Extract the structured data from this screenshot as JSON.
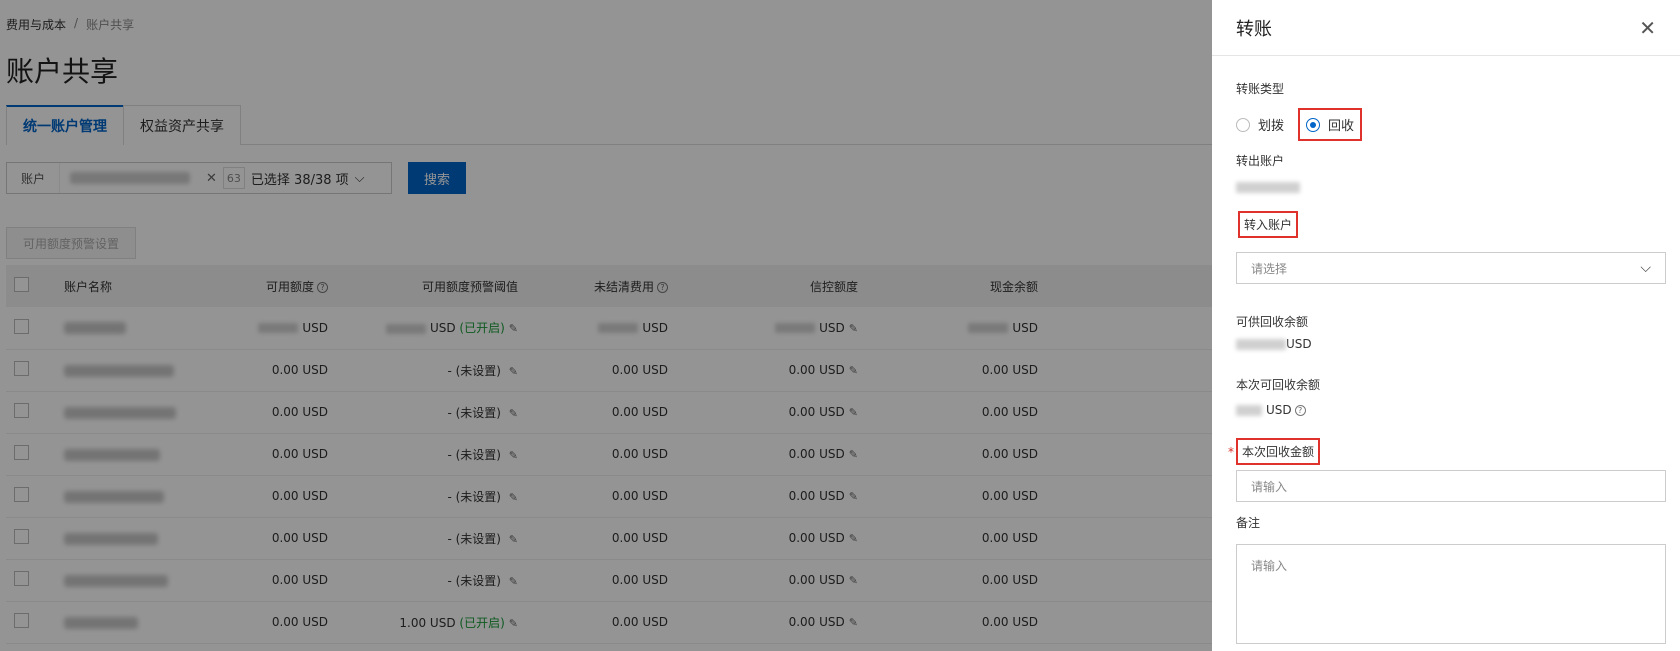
{
  "breadcrumb": {
    "root": "费用与成本",
    "sep": "/",
    "current": "账户共享"
  },
  "page_title": "账户共享",
  "tabs": [
    {
      "label": "统一账户管理",
      "active": true
    },
    {
      "label": "权益资产共享",
      "active": false
    }
  ],
  "filter": {
    "label": "账户",
    "count_box": "63",
    "selected": "已选择 38/38 项",
    "search_label": "搜索"
  },
  "toolbar": {
    "setting_label": "可用额度预警设置"
  },
  "table": {
    "headers": [
      "账户名称",
      "可用额度",
      "可用额度预警阈值",
      "未结清费用",
      "信控额度",
      "现金余额"
    ],
    "rows": [
      {
        "available": "USD",
        "threshold": "USD",
        "threshold_status": "(已开启)",
        "unpaid": "USD",
        "credit": "USD",
        "cash": "USD",
        "blurred": true
      },
      {
        "available": "0.00 USD",
        "threshold": "- (未设置)",
        "threshold_status": "",
        "unpaid": "0.00 USD",
        "credit": "0.00 USD",
        "cash": "0.00 USD",
        "blurred": false
      },
      {
        "available": "0.00 USD",
        "threshold": "- (未设置)",
        "threshold_status": "",
        "unpaid": "0.00 USD",
        "credit": "0.00 USD",
        "cash": "0.00 USD",
        "blurred": false
      },
      {
        "available": "0.00 USD",
        "threshold": "- (未设置)",
        "threshold_status": "",
        "unpaid": "0.00 USD",
        "credit": "0.00 USD",
        "cash": "0.00 USD",
        "blurred": false
      },
      {
        "available": "0.00 USD",
        "threshold": "- (未设置)",
        "threshold_status": "",
        "unpaid": "0.00 USD",
        "credit": "0.00 USD",
        "cash": "0.00 USD",
        "blurred": false
      },
      {
        "available": "0.00 USD",
        "threshold": "- (未设置)",
        "threshold_status": "",
        "unpaid": "0.00 USD",
        "credit": "0.00 USD",
        "cash": "0.00 USD",
        "blurred": false
      },
      {
        "available": "0.00 USD",
        "threshold": "- (未设置)",
        "threshold_status": "",
        "unpaid": "0.00 USD",
        "credit": "0.00 USD",
        "cash": "0.00 USD",
        "blurred": false
      },
      {
        "available": "0.00 USD",
        "threshold": "1.00 USD",
        "threshold_status": "(已开启)",
        "unpaid": "0.00 USD",
        "credit": "0.00 USD",
        "cash": "0.00 USD",
        "blurred": false
      }
    ]
  },
  "drawer": {
    "title": "转账",
    "transfer_type_label": "转账类型",
    "option_allocate": "划拨",
    "option_recycle": "回收",
    "from_account_label": "转出账户",
    "to_account_label": "转入账户",
    "to_account_placeholder": "请选择",
    "recyclable_balance_label": "可供回收余额",
    "recyclable_balance_unit": "USD",
    "current_recyclable_label": "本次可回收余额",
    "current_recyclable_unit": "USD",
    "amount_label": "本次回收金额",
    "amount_placeholder": "请输入",
    "remark_label": "备注",
    "remark_placeholder": "请输入"
  },
  "colors": {
    "primary": "#0064c8",
    "highlight_box": "#e0322c",
    "enabled_text": "#1a9c3a"
  }
}
